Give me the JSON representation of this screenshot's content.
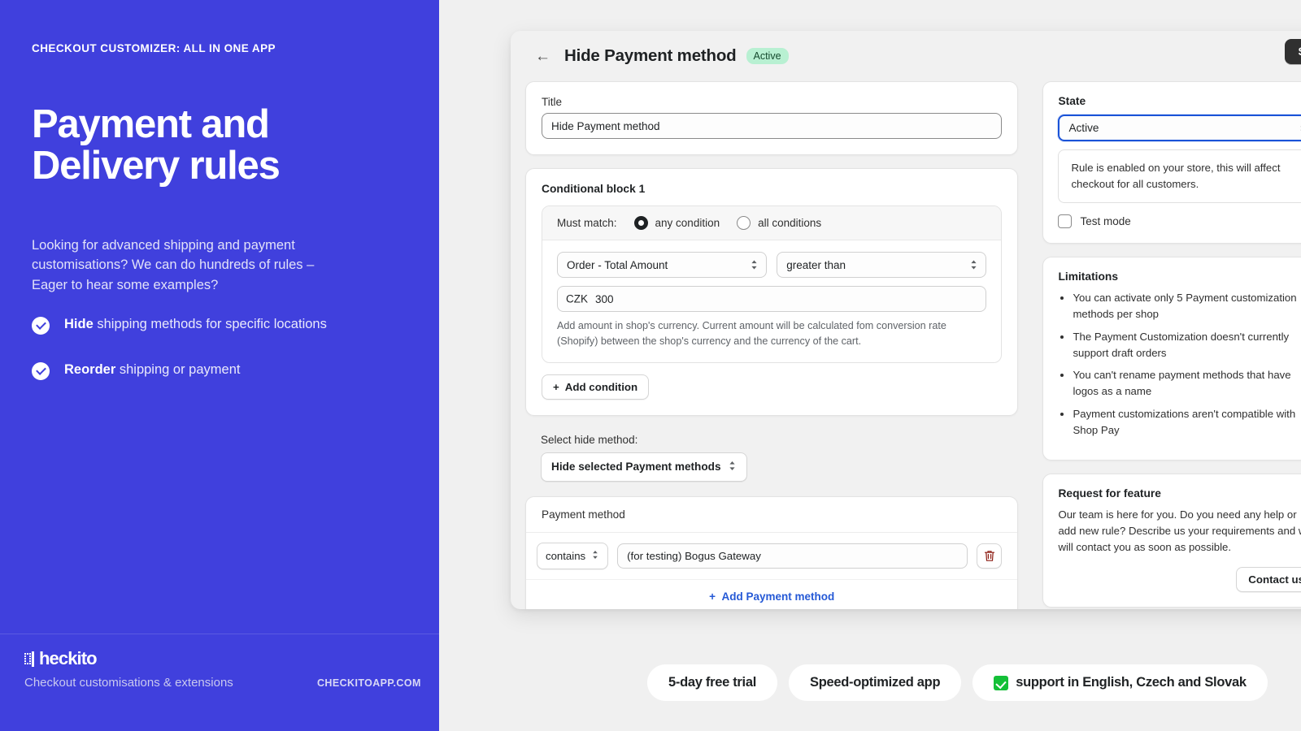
{
  "promo": {
    "eyebrow": "CHECKOUT CUSTOMIZER: ALL IN ONE APP",
    "title_line1": "Payment and",
    "title_line2": "Delivery rules",
    "subtitle": "Looking for advanced shipping and payment customisations? We can do hundreds of rules – Eager to hear some examples?",
    "bullets": [
      {
        "bold": "Hide",
        "rest": " shipping methods for specific locations"
      },
      {
        "bold": "Reorder",
        "rest": " shipping or payment"
      }
    ],
    "logo_text": "heckito",
    "tagline": "Checkout customisations & extensions",
    "site": "CHECKITOAPP.COM",
    "brand_color": "#4040dd"
  },
  "app": {
    "back_icon": "←",
    "title": "Hide Payment method",
    "status_badge": "Active",
    "save_label": "Save"
  },
  "title_card": {
    "label": "Title",
    "value": "Hide Payment method"
  },
  "conditional_block": {
    "heading": "Conditional block 1",
    "must_match_label": "Must match:",
    "options": [
      {
        "label": "any condition",
        "selected": true
      },
      {
        "label": "all conditions",
        "selected": false
      }
    ],
    "condition": {
      "field": "Order - Total Amount",
      "operator": "greater than",
      "currency_prefix": "CZK",
      "amount": "300",
      "help_text": "Add amount in shop's currency. Current amount will be calculated fom conversion rate (Shopify) between the shop's currency and the currency of the cart."
    },
    "add_condition_label": "Add condition",
    "add_icon": "+"
  },
  "hide_method": {
    "label": "Select hide method:",
    "value": "Hide selected Payment methods"
  },
  "payment_method": {
    "heading": "Payment method",
    "operator": "contains",
    "value": "(for testing) Bogus Gateway",
    "delete_icon": "trash-icon",
    "add_label": "Add Payment method",
    "add_icon": "+",
    "link_color": "#2559d6"
  },
  "state_card": {
    "heading": "State",
    "selected": "Active",
    "note": "Rule is enabled on your store, this will affect checkout for all customers.",
    "test_mode_label": "Test mode",
    "test_mode_checked": false,
    "focus_color": "#1a53d8"
  },
  "limitations_card": {
    "heading": "Limitations",
    "items": [
      "You can activate only 5 Payment customization methods per shop",
      "The Payment Customization doesn't currently support draft orders",
      "You can't rename payment methods that have logos as a name",
      "Payment customizations aren't compatible with Shop Pay"
    ]
  },
  "request_card": {
    "heading": "Request for feature",
    "body": "Our team is here for you. Do you need any help or add new rule? Describe us your requirements and we will contact you as soon as possible.",
    "button_label": "Contact us"
  },
  "bottom_pills": [
    {
      "label": "5-day free trial",
      "has_check": false
    },
    {
      "label": "Speed-optimized app",
      "has_check": false
    },
    {
      "label": "support in English, Czech and Slovak",
      "has_check": true
    }
  ]
}
